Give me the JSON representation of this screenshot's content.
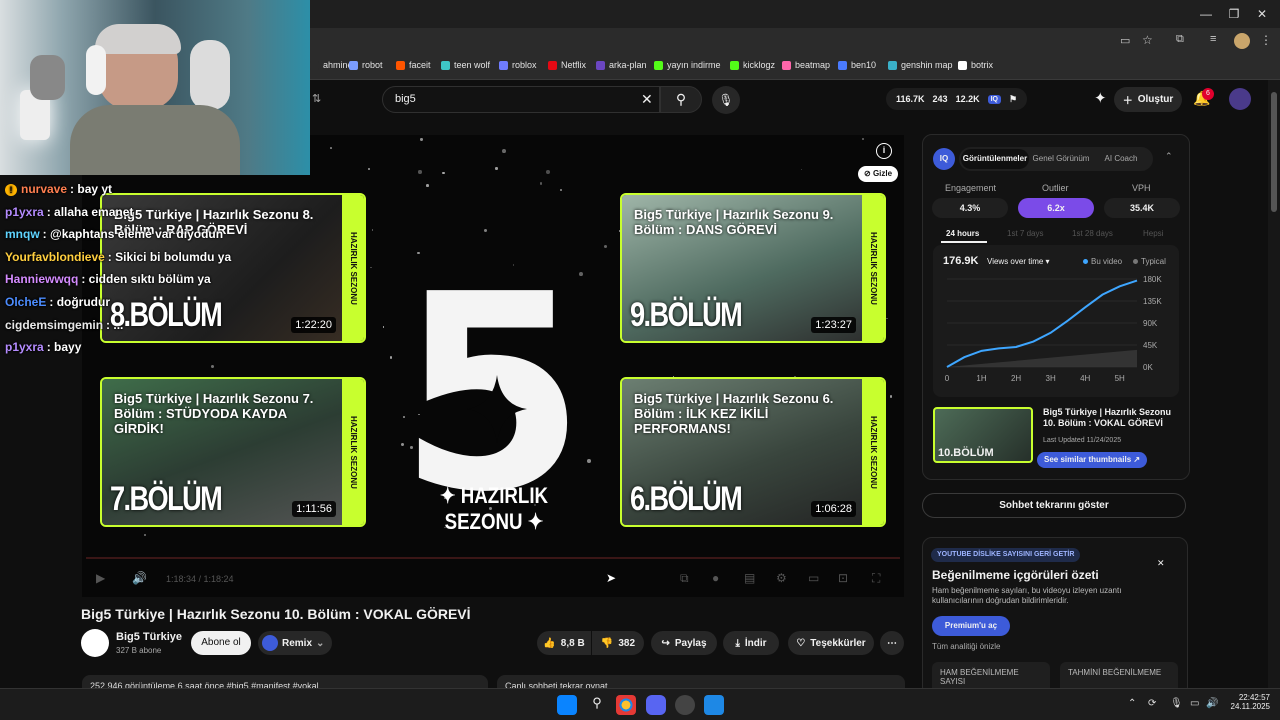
{
  "bookmarks": [
    {
      "label": "ahminet",
      "color": "#2b2b2b"
    },
    {
      "label": "robot",
      "color": "#7a9cff"
    },
    {
      "label": "faceit",
      "color": "#ff5500"
    },
    {
      "label": "teen wolf",
      "color": "#3ec7c7"
    },
    {
      "label": "roblox",
      "color": "#6f7cff"
    },
    {
      "label": "Netflix",
      "color": "#e50914"
    },
    {
      "label": "arka-plan",
      "color": "#6b46c1"
    },
    {
      "label": "yayın indirme",
      "color": "#53fc18"
    },
    {
      "label": "kicklogz",
      "color": "#53fc18"
    },
    {
      "label": "beatmap",
      "color": "#ff66aa"
    },
    {
      "label": "ben10",
      "color": "#4a7bff"
    },
    {
      "label": "genshin map",
      "color": "#3ab0c8"
    },
    {
      "label": "botrix",
      "color": "#ffffff"
    }
  ],
  "search": {
    "value": "big5"
  },
  "header": {
    "stats": [
      "116.7K",
      "243",
      "12.2K"
    ],
    "create_label": "Oluştur",
    "notif_count": "6"
  },
  "player": {
    "gizle": "Gizle",
    "sezon_label": "✦ HAZIRLIK SEZONU ✦",
    "big5_numeral": "5",
    "time": "1:18:34 / 1:18:24",
    "thumbs": [
      {
        "title": "Big5 Türkiye | Hazırlık Sezonu 8. Bölüm : RAP GÖREVİ",
        "episode": "8.BÖLÜM",
        "duration": "1:22:20",
        "side": "HAZIRLIK SEZONU"
      },
      {
        "title": "Big5 Türkiye | Hazırlık Sezonu 9. Bölüm : DANS GÖREVİ",
        "episode": "9.BÖLÜM",
        "duration": "1:23:27",
        "side": "HAZIRLIK SEZONU"
      },
      {
        "title": "Big5 Türkiye | Hazırlık Sezonu 7. Bölüm : STÜDYODA KAYDA GİRDİK!",
        "episode": "7.BÖLÜM",
        "duration": "1:11:56",
        "side": "HAZIRLIK SEZONU"
      },
      {
        "title": "Big5 Türkiye | Hazırlık Sezonu 6. Bölüm : İLK KEZ İKİLİ PERFORMANS!",
        "episode": "6.BÖLÜM",
        "duration": "1:06:28",
        "side": "HAZIRLIK SEZONU"
      }
    ]
  },
  "video": {
    "title": "Big5 Türkiye | Hazırlık Sezonu 10. Bölüm : VOKAL GÖREVİ",
    "channel": "Big5 Türkiye",
    "subs": "327 B abone",
    "subscribe": "Abone ol",
    "remix": "Remix",
    "likes": "8,8 B",
    "dislikes": "382",
    "share": "Paylaş",
    "download": "İndir",
    "thanks": "Teşekkürler",
    "desc": "252.946 görüntüleme  6 saat önce  #big5 #manifest #vokal",
    "chat": "Canlı sohbeti tekrar oynat"
  },
  "iq": {
    "badge": "IQ",
    "tabs": [
      "Görüntülenmeler",
      "Genel Görünüm",
      "AI Coach"
    ],
    "stats": [
      {
        "label": "Engagement",
        "value": "4.3%"
      },
      {
        "label": "Outlier",
        "value": "6.2x"
      },
      {
        "label": "VPH",
        "value": "35.4K"
      }
    ],
    "periods": [
      "24 hours",
      "1st 7 days",
      "1st 28 days",
      "Hepsi"
    ],
    "views": "176.9K",
    "views_select": "Views over time ▾",
    "legend_this": "Bu video",
    "legend_typical": "Typical",
    "similar_title": "Big5 Türkiye | Hazırlık Sezonu 10. Bölüm : VOKAL GÖREVİ",
    "last_updated": "Last Updated 11/24/2025",
    "similar_btn": "See similar thumbnails ↗",
    "mini_episode": "10.BÖLÜM"
  },
  "chart_data": {
    "type": "line",
    "x": [
      "0",
      "1H",
      "2H",
      "3H",
      "4H",
      "5H"
    ],
    "xlim": [
      0,
      5.5
    ],
    "ylim": [
      0,
      180
    ],
    "yticks": [
      "180K",
      "135K",
      "90K",
      "45K",
      "0K"
    ],
    "series": [
      {
        "name": "Bu video",
        "color": "#3ea6ff",
        "points": [
          [
            0,
            0
          ],
          [
            0.5,
            20
          ],
          [
            1,
            33
          ],
          [
            1.5,
            38
          ],
          [
            2,
            41
          ],
          [
            2.5,
            52
          ],
          [
            3,
            70
          ],
          [
            3.5,
            95
          ],
          [
            4,
            122
          ],
          [
            4.5,
            148
          ],
          [
            5,
            165
          ],
          [
            5.5,
            176.9
          ]
        ]
      },
      {
        "name": "Typical",
        "color": "#3a3a3a",
        "points": [
          [
            0,
            0
          ],
          [
            5.5,
            35
          ]
        ]
      }
    ]
  },
  "replay_btn": "Sohbet tekrarını göster",
  "dislike": {
    "banner": "YOUTUBE DİSLİKE SAYISINI GERİ GETİR",
    "title": "Beğenilmeme içgörüleri özeti",
    "desc": "Ham beğenilmeme sayıları, bu videoyu izleyen uzantı kullanıcılarının doğrudan bildirimleridir.",
    "premium": "Premium'u aç",
    "preview": "Tüm analitiği önizle",
    "raw": "HAM BEĞENİLMEME SAYISI",
    "est": "TAHMİNİ BEĞENİLMEME"
  },
  "chat_messages": [
    {
      "user": "nurvave",
      "text": ": bay yt",
      "color": "#ff7f50",
      "icon": "!"
    },
    {
      "user": "p1yxra",
      "text": ": allaha emanet",
      "color": "#b58cff"
    },
    {
      "user": "mnqw",
      "text": ": @kaphtans eleme var diyodun",
      "color": "#5fd4ff"
    },
    {
      "user": "Yourfavblondieve",
      "text": ": Sikici bi bolumdu ya",
      "color": "#ffcf3f"
    },
    {
      "user": "Hanniewwqq",
      "text": ": cidden sıktı bölüm ya",
      "color": "#d58cff"
    },
    {
      "user": "OlcheE",
      "text": ": doğrudur",
      "color": "#4d8dff"
    },
    {
      "user": "cigdemsimgemin",
      "text": ": ...",
      "color": "#e8e8e8"
    },
    {
      "user": "p1yxra",
      "text": ": bayy",
      "color": "#b58cff"
    }
  ],
  "taskbar": {
    "time": "22:42:57",
    "date": "24.11.2025"
  }
}
